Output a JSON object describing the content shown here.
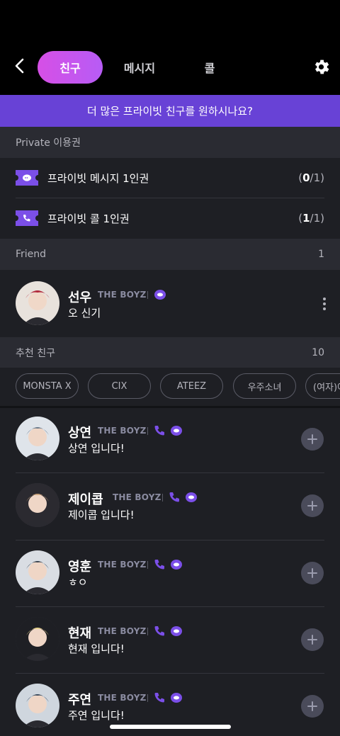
{
  "nav": {
    "tabs": [
      {
        "label": "친구",
        "active": true
      },
      {
        "label": "메시지",
        "active": false
      },
      {
        "label": "콜",
        "active": false
      }
    ]
  },
  "promo": {
    "text": "더 많은 프라이빗 친구를 원하시나요?"
  },
  "private_section": {
    "title": "Private 이용권",
    "tickets": [
      {
        "icon": "message-ticket-icon",
        "label": "프라이빗 메시지 1인권",
        "used": "0",
        "total": "1"
      },
      {
        "icon": "call-ticket-icon",
        "label": "프라이빗 콜 1인권",
        "used": "1",
        "total": "1"
      }
    ]
  },
  "friend_section": {
    "title": "Friend",
    "count": "1",
    "friends": [
      {
        "name": "선우",
        "group": "THE BOYZ",
        "status": "오 신기",
        "icons": [
          "message-icon"
        ]
      }
    ]
  },
  "recommend_section": {
    "title": "추천 친구",
    "count": "10",
    "chips": [
      "MONSTA X",
      "CIX",
      "ATEEZ",
      "우주소녀",
      "(여자)아이들"
    ],
    "items": [
      {
        "name": "상연",
        "group": "THE BOYZ",
        "status": "상연 입니다!"
      },
      {
        "name": "제이콥",
        "group": "THE BOYZ",
        "status": "제이콥 입니다!"
      },
      {
        "name": "영훈",
        "group": "THE BOYZ",
        "status": "ㅎㅇ"
      },
      {
        "name": "현재",
        "group": "THE BOYZ",
        "status": "현재 입니다!"
      },
      {
        "name": "주연",
        "group": "THE BOYZ",
        "status": "주연 입니다!"
      }
    ]
  },
  "colors": {
    "accent": "#7b4fe8",
    "promo_bg": "#6842d6",
    "tab_gradient_start": "#d64fe6",
    "tab_gradient_end": "#b75cf5"
  }
}
